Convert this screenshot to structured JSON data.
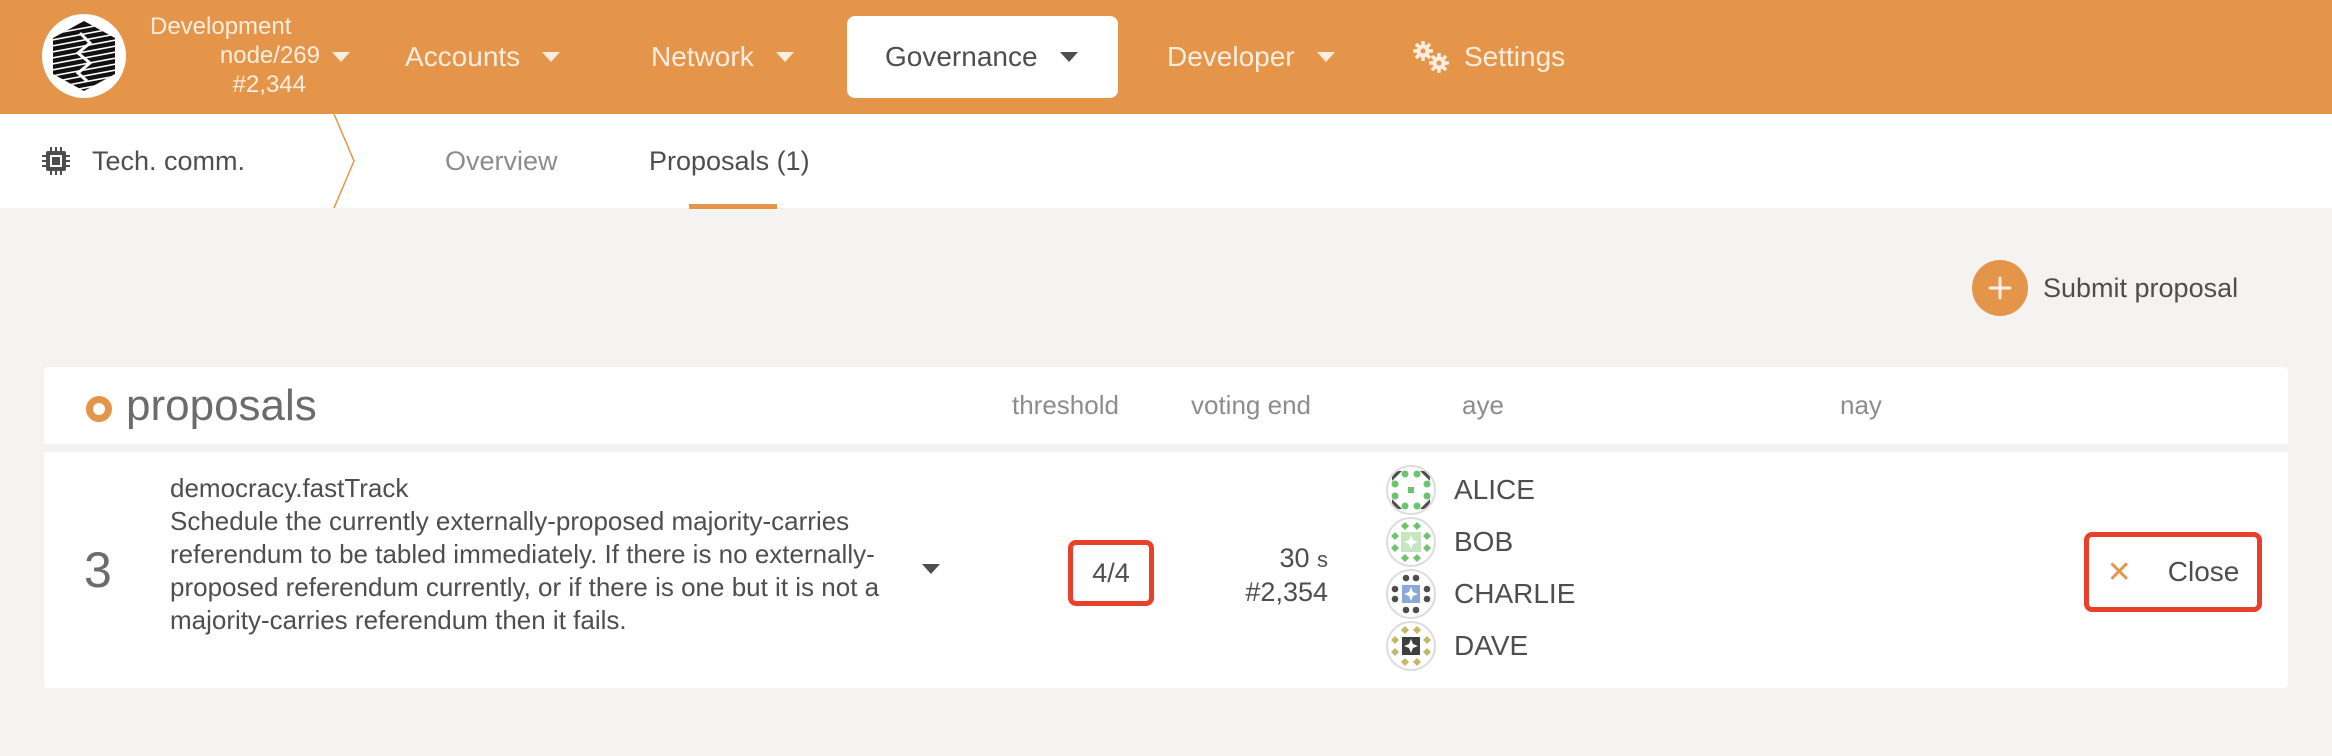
{
  "topbar": {
    "logo_icon": "substrate-hexagon-logo",
    "chain": {
      "name": "Development",
      "node": "node/269",
      "block": "#2,344"
    },
    "nav": [
      {
        "label": "Accounts",
        "has_dropdown": true,
        "active": false
      },
      {
        "label": "Network",
        "has_dropdown": true,
        "active": false
      },
      {
        "label": "Governance",
        "has_dropdown": true,
        "active": true
      },
      {
        "label": "Developer",
        "has_dropdown": true,
        "active": false
      },
      {
        "label": "Settings",
        "icon": "gears-icon",
        "has_dropdown": false,
        "active": false
      }
    ]
  },
  "subnav": {
    "section": {
      "icon": "chip-icon",
      "label": "Tech. comm."
    },
    "tabs": [
      {
        "label": "Overview",
        "active": false
      },
      {
        "label": "Proposals (1)",
        "active": true
      }
    ]
  },
  "actions": {
    "submit_label": "Submit proposal",
    "submit_icon": "plus-icon"
  },
  "table": {
    "title": "proposals",
    "columns": [
      "threshold",
      "voting end",
      "aye",
      "nay"
    ],
    "rows": [
      {
        "index": "3",
        "call": "democracy.fastTrack",
        "description": "Schedule the currently externally-proposed majority-carries referendum to be tabled immediately. If there is no externally-proposed referendum currently, or if there is one but it is not a majority-carries referendum then it fails.",
        "threshold": "4/4",
        "voting_end_time": "30",
        "voting_end_unit": "s",
        "voting_end_block": "#2,354",
        "aye": [
          "ALICE",
          "BOB",
          "CHARLIE",
          "DAVE"
        ],
        "nay": [],
        "close_label": "Close",
        "close_icon": "x-icon"
      }
    ]
  },
  "colors": {
    "accent": "#e4954a",
    "highlight": "#e8402a",
    "background": "#f4f3f2",
    "text": "#4e4e4e"
  }
}
